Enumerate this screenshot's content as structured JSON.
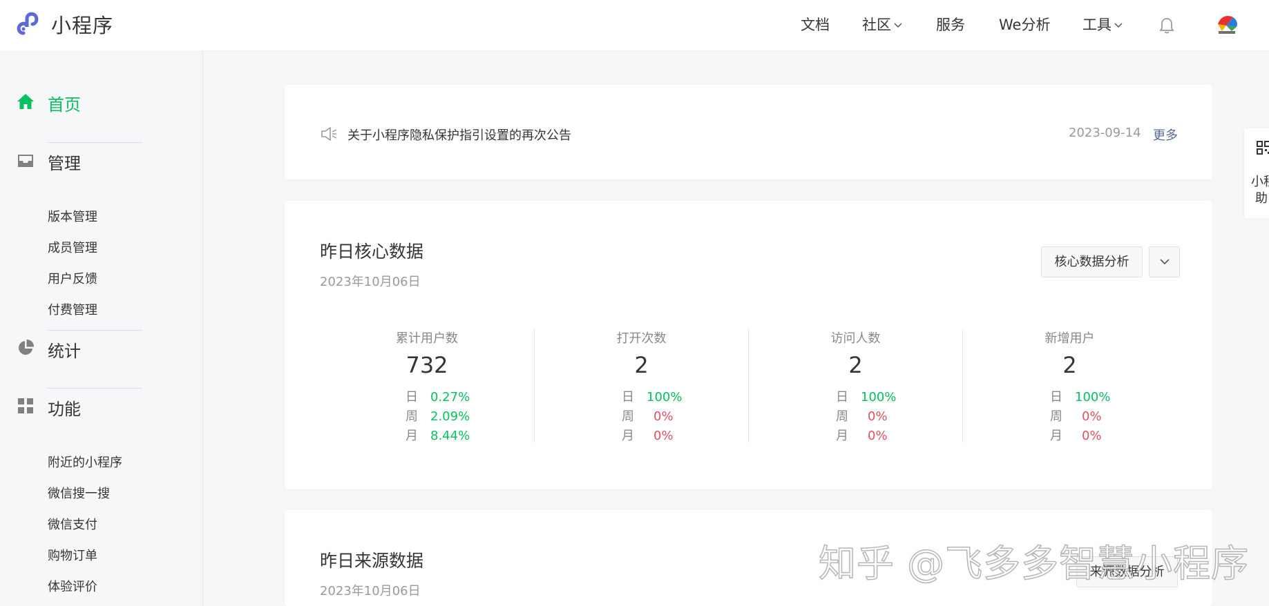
{
  "header": {
    "app_title": "小程序",
    "nav": [
      {
        "label": "文档",
        "dropdown": false
      },
      {
        "label": "社区",
        "dropdown": true
      },
      {
        "label": "服务",
        "dropdown": false
      },
      {
        "label": "We分析",
        "dropdown": false
      },
      {
        "label": "工具",
        "dropdown": true
      }
    ],
    "bell_icon": "bell-icon",
    "avatar_icon": "user-avatar"
  },
  "sidebar": {
    "home": {
      "label": "首页",
      "icon": "home-icon",
      "active": true
    },
    "manage": {
      "label": "管理",
      "icon": "inbox-icon",
      "items": [
        "版本管理",
        "成员管理",
        "用户反馈",
        "付费管理"
      ]
    },
    "stats": {
      "label": "统计",
      "icon": "pie-chart-icon"
    },
    "features": {
      "label": "功能",
      "icon": "grid-icon",
      "items": [
        "附近的小程序",
        "微信搜一搜",
        "微信支付",
        "购物订单",
        "体验评价"
      ]
    }
  },
  "notice": {
    "title": "关于小程序隐私保护指引设置的再次公告",
    "date": "2023-09-14",
    "more_label": "更多"
  },
  "core_data": {
    "title": "昨日核心数据",
    "date": "2023年10月06日",
    "analysis_button": "核心数据分析",
    "metrics": [
      {
        "label": "累计用户数",
        "value": "732",
        "rows": [
          {
            "k": "日",
            "v": "0.27%",
            "trend": "up"
          },
          {
            "k": "周",
            "v": "2.09%",
            "trend": "up"
          },
          {
            "k": "月",
            "v": "8.44%",
            "trend": "up"
          }
        ]
      },
      {
        "label": "打开次数",
        "value": "2",
        "rows": [
          {
            "k": "日",
            "v": "100%",
            "trend": "up"
          },
          {
            "k": "周",
            "v": "0%",
            "trend": "down"
          },
          {
            "k": "月",
            "v": "0%",
            "trend": "down"
          }
        ]
      },
      {
        "label": "访问人数",
        "value": "2",
        "rows": [
          {
            "k": "日",
            "v": "100%",
            "trend": "up"
          },
          {
            "k": "周",
            "v": "0%",
            "trend": "down"
          },
          {
            "k": "月",
            "v": "0%",
            "trend": "down"
          }
        ]
      },
      {
        "label": "新增用户",
        "value": "2",
        "rows": [
          {
            "k": "日",
            "v": "100%",
            "trend": "up"
          },
          {
            "k": "周",
            "v": "0%",
            "trend": "down"
          },
          {
            "k": "月",
            "v": "0%",
            "trend": "down"
          }
        ]
      }
    ]
  },
  "source_data": {
    "title": "昨日来源数据",
    "date": "2023年10月06日",
    "analysis_button": "来源数据分析"
  },
  "helper": {
    "label_line1": "小程",
    "label_line2": "助"
  },
  "watermark": "知乎 @飞多多智慧小程序",
  "colors": {
    "accent_green": "#07c160",
    "down_red": "#e05260",
    "link_blue": "#576b95"
  }
}
